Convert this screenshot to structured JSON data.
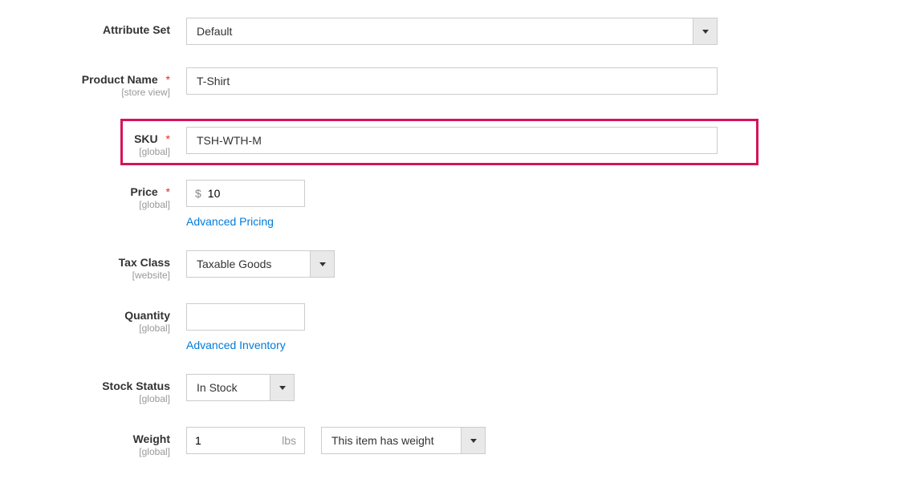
{
  "attribute_set": {
    "label": "Attribute Set",
    "value": "Default"
  },
  "product_name": {
    "label": "Product Name",
    "scope": "[store view]",
    "value": "T-Shirt"
  },
  "sku": {
    "label": "SKU",
    "scope": "[global]",
    "value": "TSH-WTH-M"
  },
  "price": {
    "label": "Price",
    "scope": "[global]",
    "currency": "$",
    "value": "10",
    "advanced_link": "Advanced Pricing"
  },
  "tax_class": {
    "label": "Tax Class",
    "scope": "[website]",
    "value": "Taxable Goods"
  },
  "quantity": {
    "label": "Quantity",
    "scope": "[global]",
    "value": "",
    "advanced_link": "Advanced Inventory"
  },
  "stock_status": {
    "label": "Stock Status",
    "scope": "[global]",
    "value": "In Stock"
  },
  "weight": {
    "label": "Weight",
    "scope": "[global]",
    "value": "1",
    "unit": "lbs",
    "has_weight": "This item has weight"
  },
  "required_marker": "*"
}
